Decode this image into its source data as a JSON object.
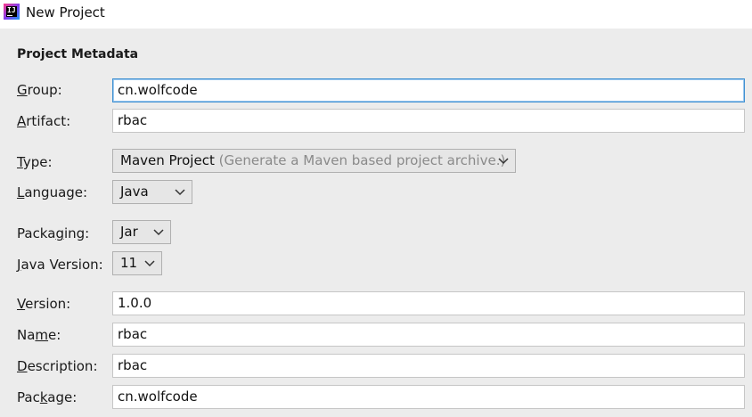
{
  "window": {
    "title": "New Project",
    "icon": "intellij-idea-icon",
    "icon_text": "IJ"
  },
  "section": {
    "title": "Project Metadata"
  },
  "fields": {
    "group": {
      "label": "Group:",
      "mnemonic": "G",
      "rest": "roup:",
      "value": "cn.wolfcode"
    },
    "artifact": {
      "label": "Artifact:",
      "mnemonic": "A",
      "rest": "rtifact:",
      "value": "rbac"
    },
    "type": {
      "label": "Type:",
      "mnemonic": "T",
      "rest": "ype:",
      "value": "Maven Project",
      "hint": "(Generate a Maven based project archive.)"
    },
    "language": {
      "label": "Language:",
      "mnemonic": "L",
      "rest": "anguage:",
      "value": "Java"
    },
    "packaging": {
      "label": "Packaging:",
      "pre": "Packa",
      "mnemonic": "g",
      "rest": "ing:",
      "value": "Jar"
    },
    "java_version": {
      "label": "Java Version:",
      "mnemonic": "J",
      "rest": "ava Version:",
      "value": "11"
    },
    "version": {
      "label": "Version:",
      "mnemonic": "V",
      "rest": "ersion:",
      "value": "1.0.0"
    },
    "name": {
      "label": "Name:",
      "pre": "Na",
      "mnemonic": "m",
      "rest": "e:",
      "value": "rbac"
    },
    "description": {
      "label": "Description:",
      "mnemonic": "D",
      "rest": "escription:",
      "value": "rbac"
    },
    "package": {
      "label": "Package:",
      "pre": "Pac",
      "mnemonic": "k",
      "rest": "age:",
      "value": "cn.wolfcode"
    }
  },
  "colors": {
    "focus_border": "#3d8fd1",
    "background": "#ececec",
    "hint_text": "#8a8a8a"
  }
}
